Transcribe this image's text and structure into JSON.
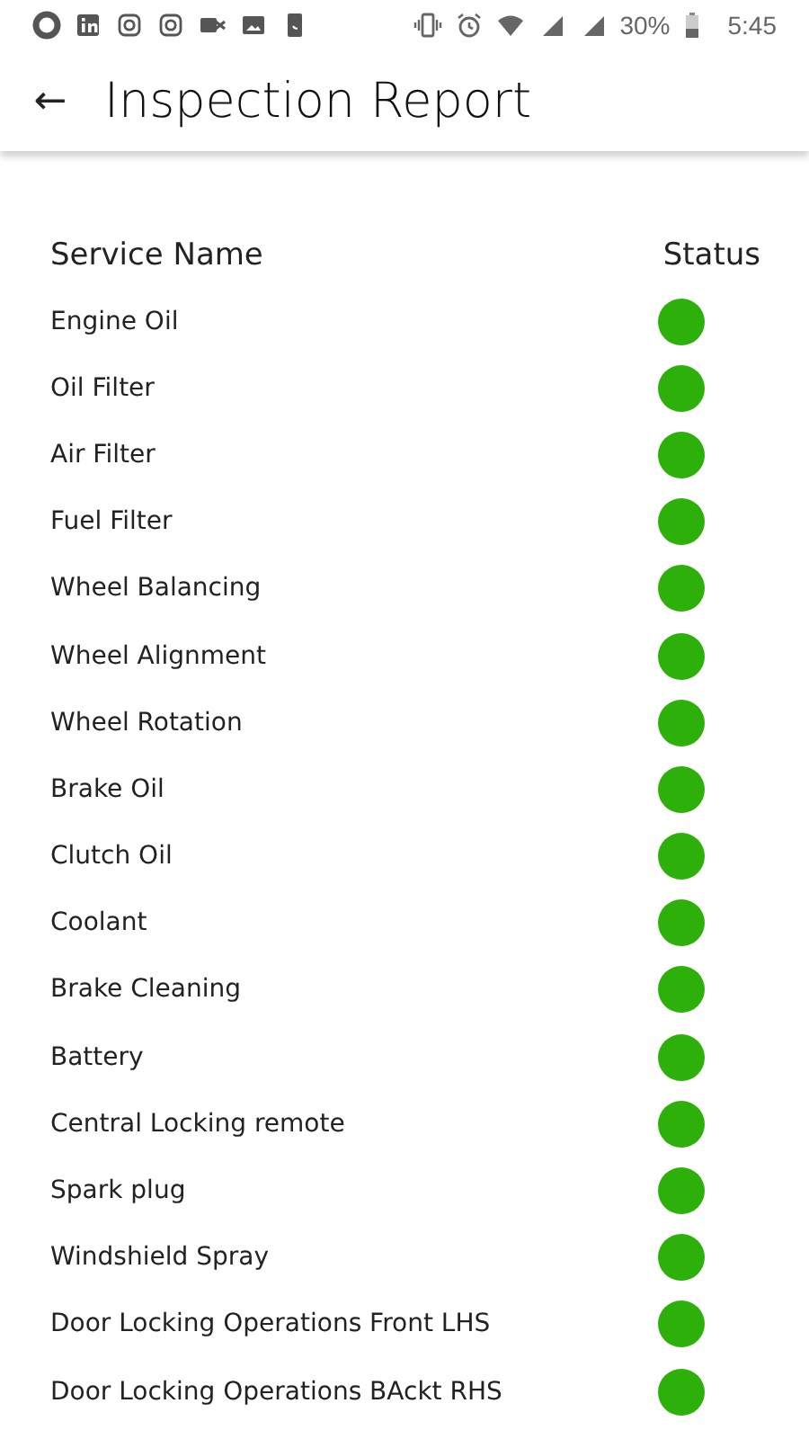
{
  "status_bar": {
    "battery_text": "30%",
    "time": "5:45"
  },
  "app_bar": {
    "back_glyph": "←",
    "title": "Inspection Report"
  },
  "table": {
    "columns": [
      "Service Name",
      "Status"
    ],
    "rows": [
      {
        "name": "Engine Oil",
        "color": "#2db10a"
      },
      {
        "name": "Oil Filter",
        "color": "#2db10a"
      },
      {
        "name": "Air Filter",
        "color": "#2db10a"
      },
      {
        "name": "Fuel Filter",
        "color": "#2db10a"
      },
      {
        "name": "Wheel Balancing",
        "color": "#2db10a"
      },
      {
        "name": "Wheel Alignment",
        "color": "#2db10a"
      },
      {
        "name": "Wheel Rotation",
        "color": "#2db10a"
      },
      {
        "name": "Brake Oil",
        "color": "#2db10a"
      },
      {
        "name": "Clutch Oil",
        "color": "#2db10a"
      },
      {
        "name": "Coolant",
        "color": "#2db10a"
      },
      {
        "name": "Brake Cleaning",
        "color": "#2db10a"
      },
      {
        "name": "Battery",
        "color": "#2db10a"
      },
      {
        "name": "Central Locking remote",
        "color": "#2db10a"
      },
      {
        "name": "Spark plug",
        "color": "#2db10a"
      },
      {
        "name": "Windshield Spray",
        "color": "#2db10a"
      },
      {
        "name": "Door Locking Operations Front LHS",
        "color": "#2db10a"
      },
      {
        "name": "Door Locking Operations BAckt RHS",
        "color": "#2db10a"
      }
    ]
  }
}
